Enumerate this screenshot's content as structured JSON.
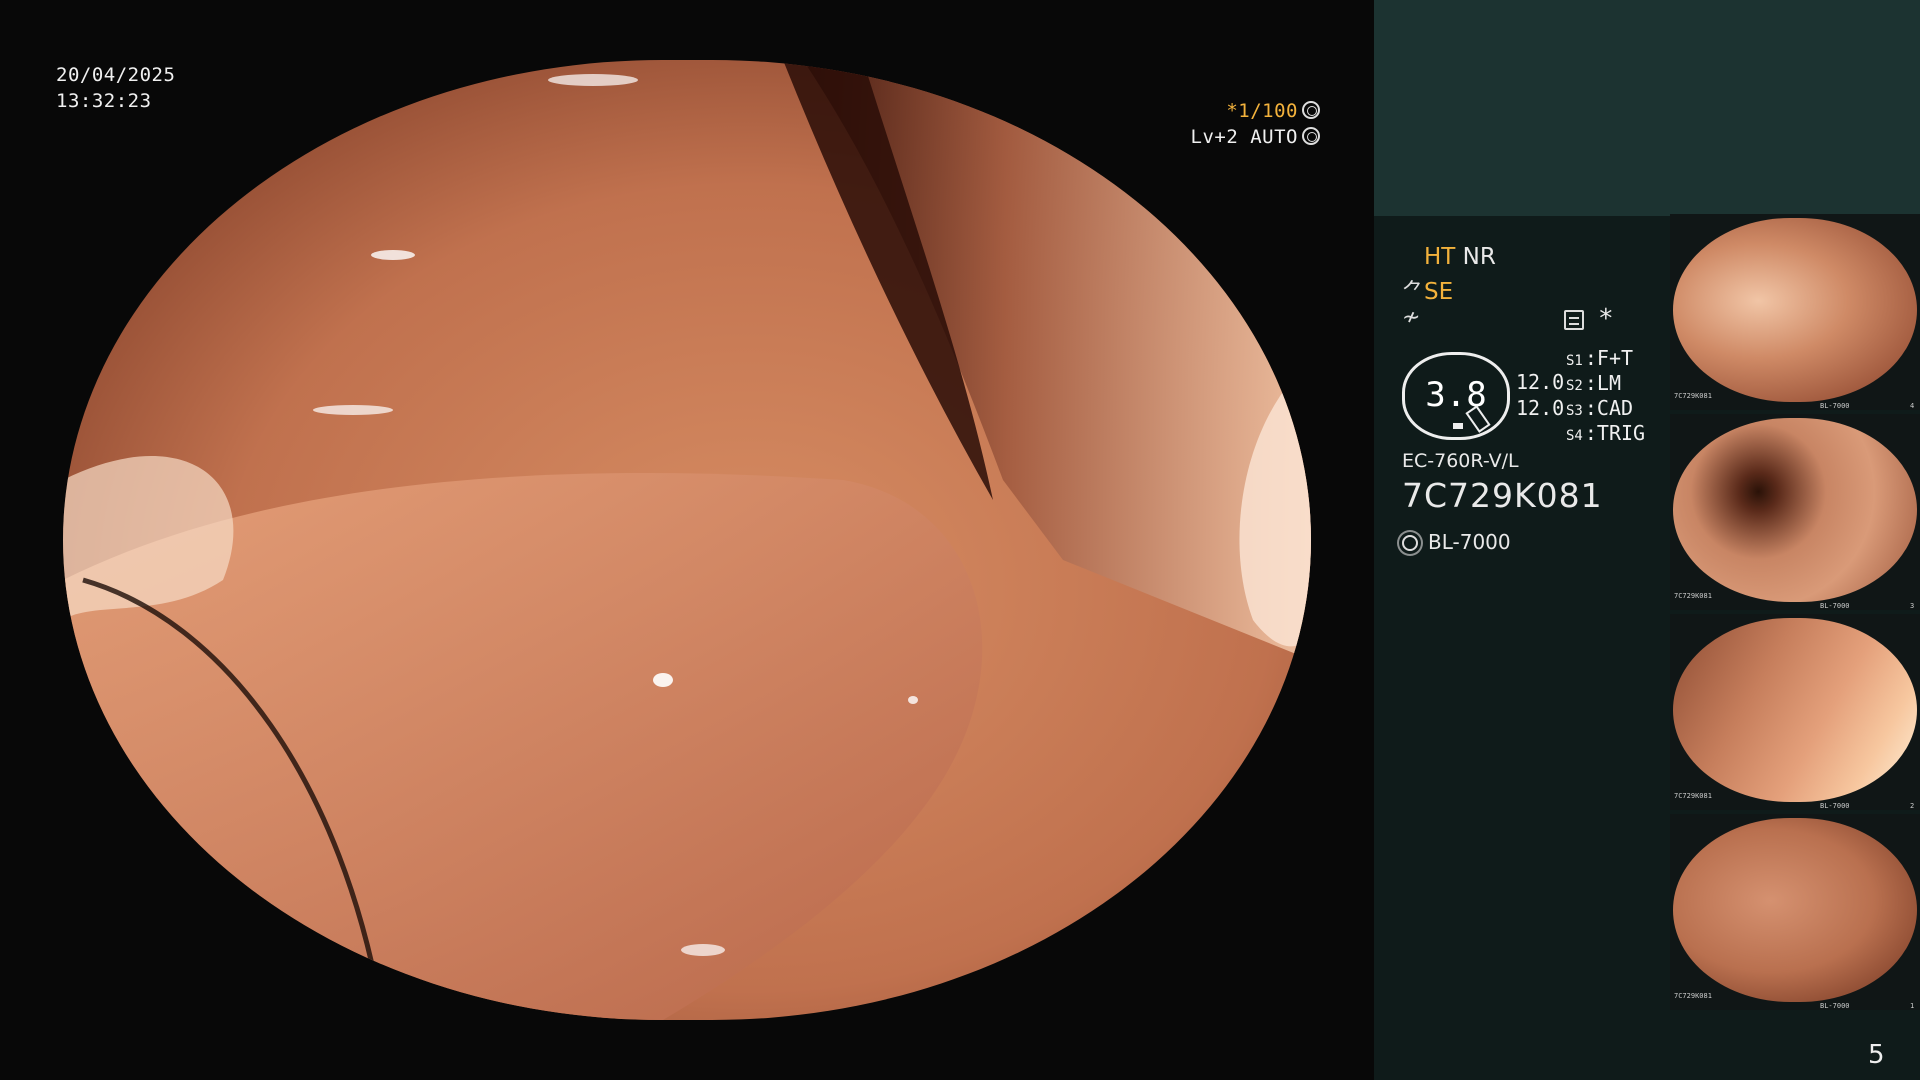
{
  "overlay": {
    "date": "20/04/2025",
    "time": "13:32:23",
    "shutter_prefix": "*",
    "shutter": "1/100",
    "level": "Lv+2",
    "auto": "AUTO"
  },
  "panel": {
    "ht": "HT",
    "nr": "NR",
    "se": "SE",
    "gauge_value": "3.8",
    "values": [
      "12.0",
      "12.0"
    ],
    "switches": [
      {
        "key": "S1",
        "label": "F+T"
      },
      {
        "key": "S2",
        "label": "LM"
      },
      {
        "key": "S3",
        "label": "CAD"
      },
      {
        "key": "S4",
        "label": "TRIG"
      }
    ],
    "scope_model": "EC-760R-V/L",
    "serial": "7C729K081",
    "light_source": "BL-7000",
    "page": "5"
  },
  "thumbnails": [
    {
      "index": "4",
      "serial": "7C729K081",
      "light": "BL-7000"
    },
    {
      "index": "3",
      "serial": "7C729K081",
      "light": "BL-7000"
    },
    {
      "index": "2",
      "serial": "7C729K081",
      "light": "BL-7000"
    },
    {
      "index": "1",
      "serial": "7C729K081",
      "light": "BL-7000"
    }
  ],
  "icons": {
    "shutter": "aperture-icon",
    "auto": "iris-icon",
    "settings": "settings-icon",
    "light": "sun-icon"
  },
  "colors": {
    "accent": "#f3b23c",
    "panel": "#0f1b1a",
    "panel_top": "#1c3331",
    "tissue": "#c77c5b"
  }
}
